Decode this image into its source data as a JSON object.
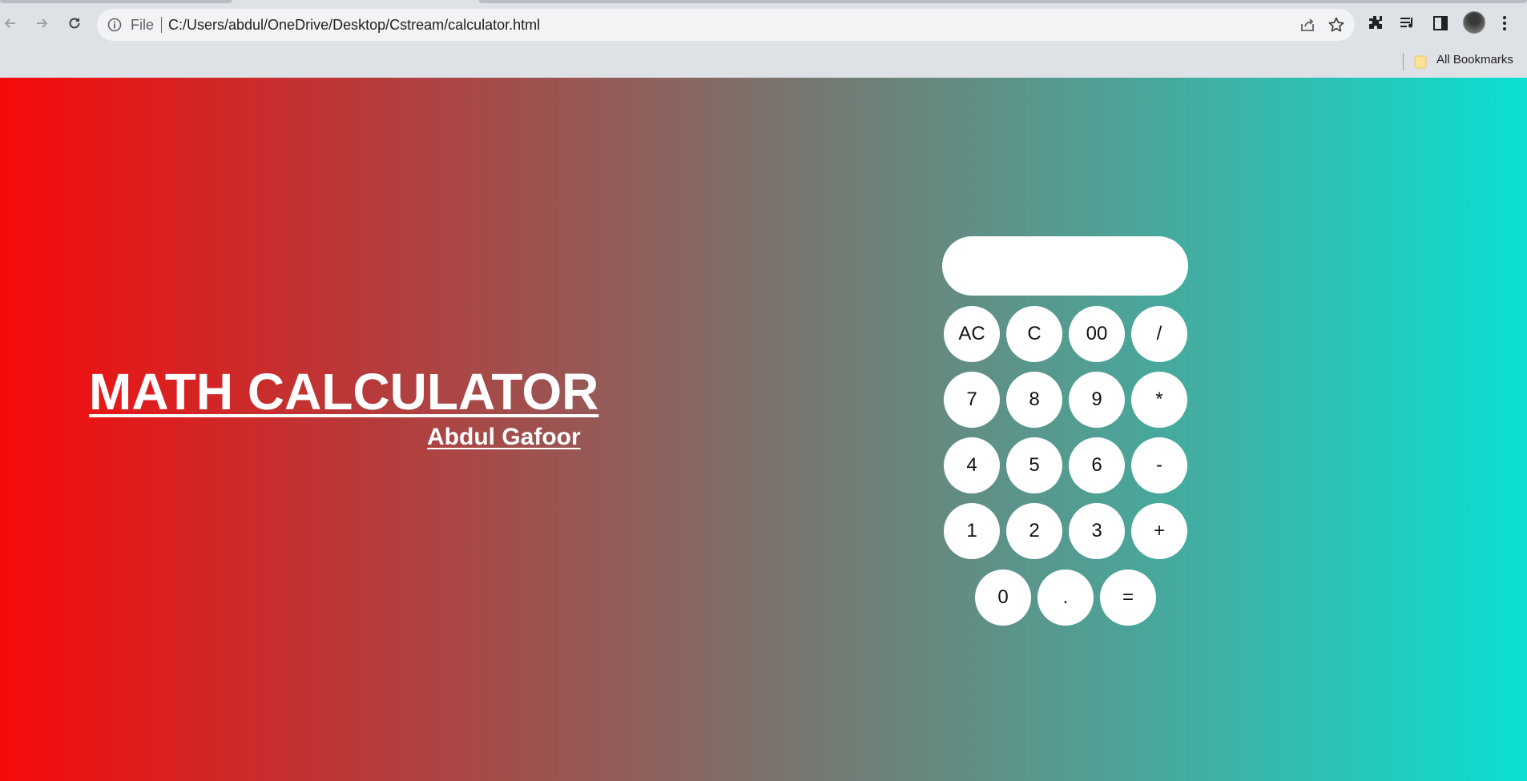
{
  "browser": {
    "scheme_label": "File",
    "url": "C:/Users/abdul/OneDrive/Desktop/Cstream/calculator.html",
    "bookmarks_label": "All Bookmarks"
  },
  "page": {
    "title": "MATH CALCULATOR",
    "author": "Abdul Gafoor",
    "display_value": "",
    "gradient": [
      "#f70a0a",
      "#0ae0d2"
    ]
  },
  "keypad": {
    "rows": [
      [
        "AC",
        "C",
        "00",
        "/"
      ],
      [
        "7",
        "8",
        "9",
        "*"
      ],
      [
        "4",
        "5",
        "6",
        "-"
      ],
      [
        "1",
        "2",
        "3",
        "+"
      ],
      [
        "0",
        ".",
        "="
      ]
    ]
  }
}
